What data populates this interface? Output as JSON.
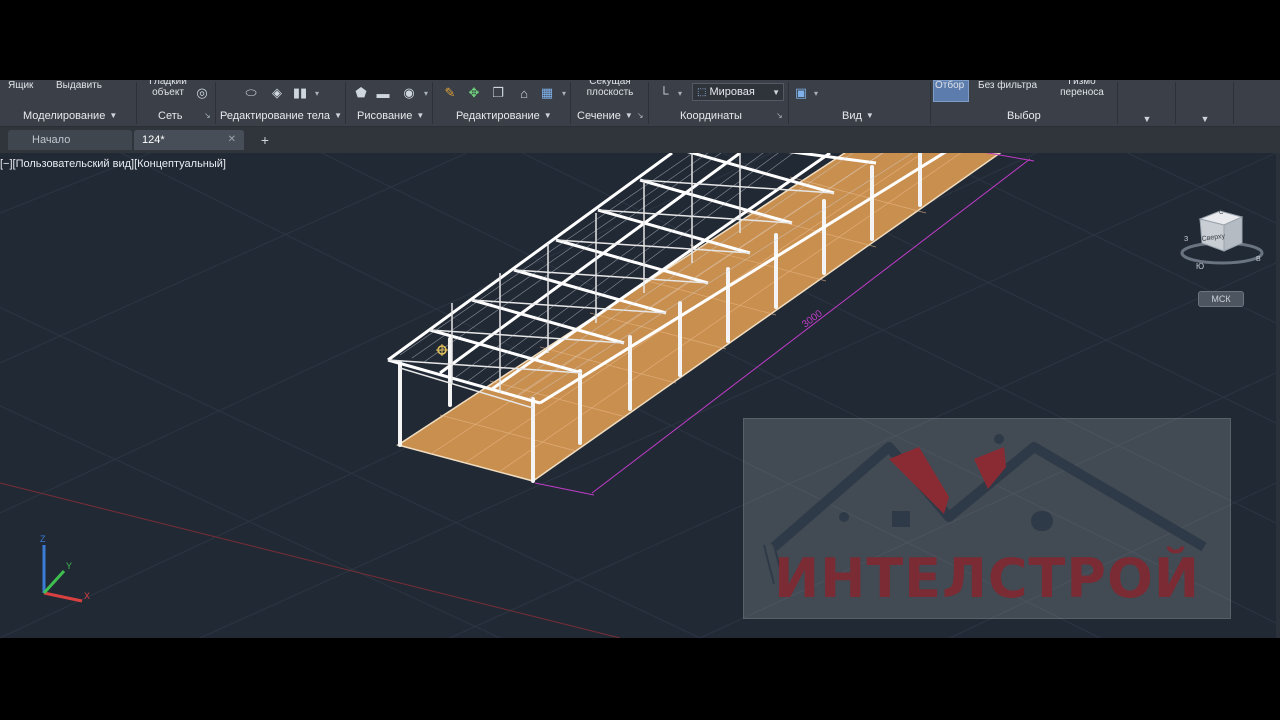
{
  "ribbon": {
    "top_fragments": {
      "a": "Ящик",
      "b": "Выдавить",
      "c": "Гладкий\nобъект",
      "d": "Секущая\nплоскость",
      "e": "Отбор",
      "f": "Без фильтра",
      "g": "Гизмо\nпереноса"
    },
    "panels": {
      "modeling": "Моделирование",
      "mesh": "Сеть",
      "solid_edit": "Редактирование тела",
      "draw": "Рисование",
      "edit": "Редактирование",
      "section": "Сечение",
      "coordinates": "Координаты",
      "view": "Вид",
      "selection": "Выбор"
    },
    "coordinate_combo": "Мировая"
  },
  "tabs": {
    "start": "Начало",
    "drawing": "124*",
    "add": "+"
  },
  "viewport": {
    "label": "[−][Пользовательский вид][Концептуальный]",
    "dimension_text": "3000",
    "viewcube": {
      "face": "Сверху",
      "north": "С",
      "south": "Ю",
      "west": "З",
      "east": "В"
    },
    "wcs_button": "МСК",
    "ucs_axes": {
      "x": "X",
      "y": "Y",
      "z": "Z"
    }
  },
  "watermark": {
    "text": "ИНТЕЛСТРОЙ"
  },
  "colors": {
    "background": "#212935",
    "floor": "#c98f4f",
    "frame": "#f2f2f2",
    "dimension": "#c03cc8",
    "logo_text": "#7a2b33"
  }
}
